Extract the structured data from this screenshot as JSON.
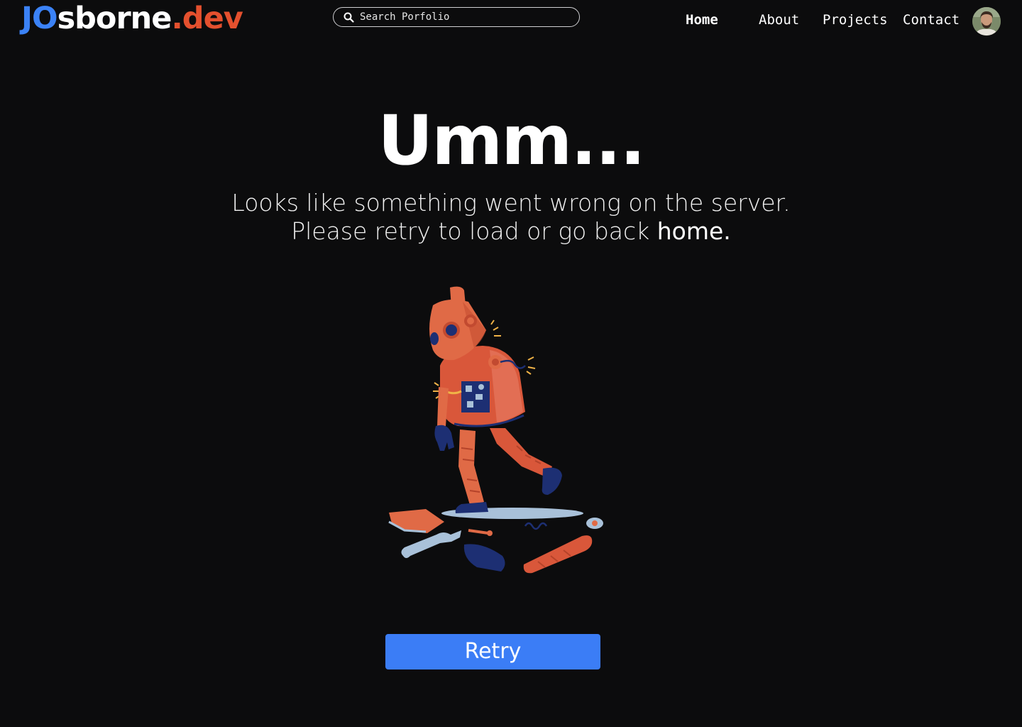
{
  "header": {
    "logo": {
      "part1": "JO",
      "part2": "sborne",
      "part3": ".dev"
    },
    "search": {
      "placeholder": "Search Porfolio"
    },
    "nav": [
      {
        "label": "Home"
      },
      {
        "label": "About"
      },
      {
        "label": "Projects"
      },
      {
        "label": "Contact"
      }
    ],
    "avatar_icon": "user-avatar"
  },
  "main": {
    "title": "Umm...",
    "message": "Looks like something went wrong on the server. Please retry to load or go back",
    "home_link": "home.",
    "illustration_icon": "broken-robot-illustration",
    "retry_label": "Retry"
  },
  "colors": {
    "background": "#0c0c0d",
    "logo_blue": "#3b82f6",
    "logo_orange": "#e4502e",
    "button_blue": "#3b7df6"
  }
}
